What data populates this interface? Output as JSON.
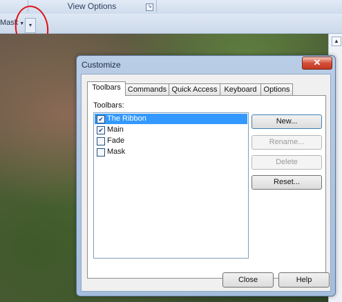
{
  "ribbon": {
    "group_caption": "View Options",
    "launcher_icon": "dialog-launcher-icon"
  },
  "qat": {
    "mask_label": "Mask",
    "customize_icon": "qat-dropdown-icon"
  },
  "dialog": {
    "title": "Customize",
    "close_glyph": "✕",
    "tabs": [
      "Toolbars",
      "Commands",
      "Quick Access",
      "Keyboard",
      "Options"
    ],
    "active_tab": "Toolbars",
    "list_caption": "Toolbars:",
    "toolbars": [
      {
        "label": "The Ribbon",
        "checked": true,
        "selected": true
      },
      {
        "label": "Main",
        "checked": true,
        "selected": false
      },
      {
        "label": "Fade",
        "checked": false,
        "selected": false
      },
      {
        "label": "Mask",
        "checked": false,
        "selected": false
      }
    ],
    "buttons": {
      "new": "New...",
      "rename": "Rename...",
      "delete": "Delete",
      "reset": "Reset..."
    },
    "footer": {
      "close": "Close",
      "help": "Help"
    }
  },
  "colors": {
    "selection": "#3399ff",
    "annotation_circle": "#e01010",
    "close_button": "#d4503a"
  }
}
